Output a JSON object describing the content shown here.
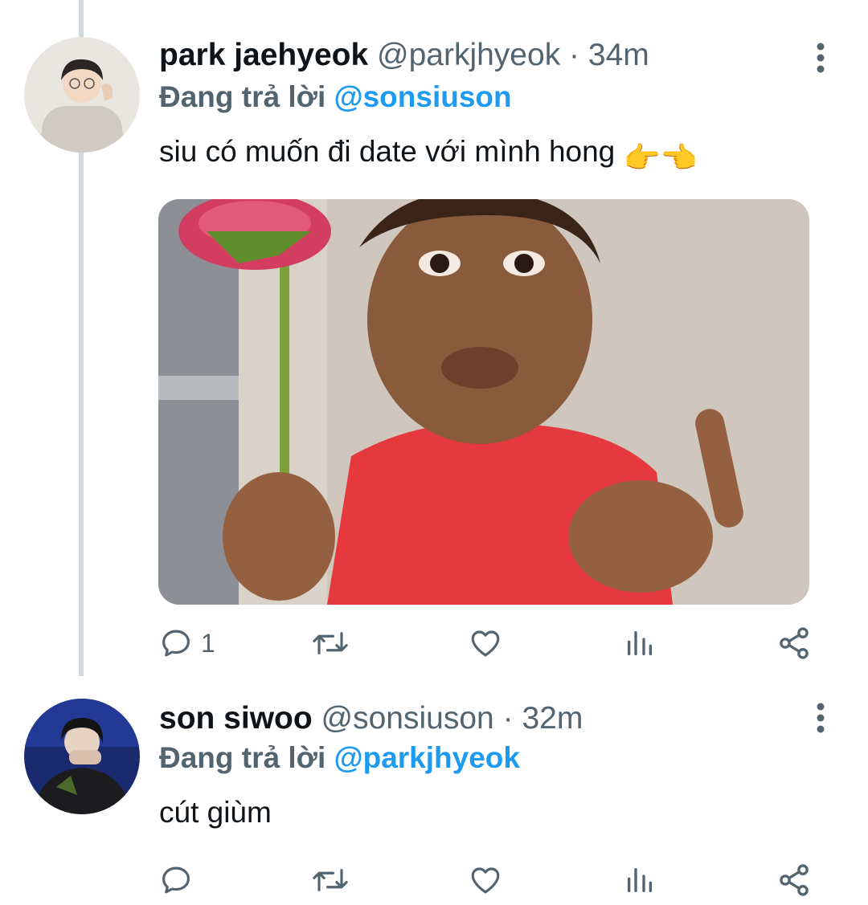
{
  "tweets": [
    {
      "author_name": "park jaehyeok",
      "handle": "@parkjhyeok",
      "separator": "·",
      "time": "34m",
      "reply_prefix": "Đang trả lời",
      "reply_to": "@sonsiuson",
      "text": "siu có muốn đi date với mình hong",
      "emoji": "👉👈",
      "reply_count": "1",
      "has_media": true
    },
    {
      "author_name": "son siwoo",
      "handle": "@sonsiuson",
      "separator": "·",
      "time": "32m",
      "reply_prefix": "Đang trả lời",
      "reply_to": "@parkjhyeok",
      "text": "cút giùm",
      "reply_count": ""
    }
  ],
  "icons": {
    "reply": "reply-icon",
    "retweet": "retweet-icon",
    "like": "heart-icon",
    "views": "views-icon",
    "share": "share-icon",
    "more": "more-vertical-icon"
  },
  "colors": {
    "accent": "#1d9bf0",
    "secondary_text": "#536471",
    "primary_text": "#0f1419",
    "thread_line": "#cfd9de"
  }
}
